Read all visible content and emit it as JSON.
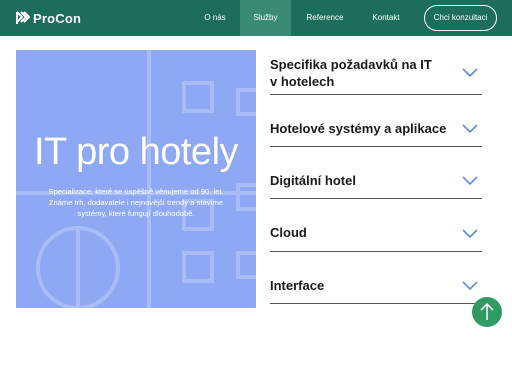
{
  "brand": {
    "name": "ProCon",
    "logo_icon": "procon-logo-icon"
  },
  "nav": {
    "items": [
      {
        "label": "O nás"
      },
      {
        "label": "Služby",
        "active": true
      },
      {
        "label": "Reference"
      },
      {
        "label": "Kontakt"
      }
    ],
    "cta_label": "Chci konzultaci"
  },
  "hero": {
    "title": "IT pro hotely",
    "text": "Specializace, které se úspěšně věnujeme od 90. let. Známe trh, dodavatele i nejnovější trendy a stavíme systémy, které fungují dlouhodobě."
  },
  "accordion": {
    "items": [
      {
        "title": "Specifika požadavků na IT v hotelech",
        "icon": "chevron-down-icon"
      },
      {
        "title": "Hotelové systémy a aplikace",
        "icon": "chevron-down-icon"
      },
      {
        "title": "Digitální hotel",
        "icon": "chevron-down-icon"
      },
      {
        "title": "Cloud",
        "icon": "chevron-down-icon"
      },
      {
        "title": "Interface",
        "icon": "chevron-down-icon"
      }
    ]
  },
  "scroll_top": {
    "icon": "arrow-up-icon"
  },
  "colors": {
    "header_bg": "#1c6e5a",
    "nav_active_bg": "#3a8a74",
    "hero_bg": "#8ea8f3",
    "chevron": "#5b8de0",
    "scroll_button": "#2f9a63",
    "text_dark": "#1a1a1a"
  }
}
